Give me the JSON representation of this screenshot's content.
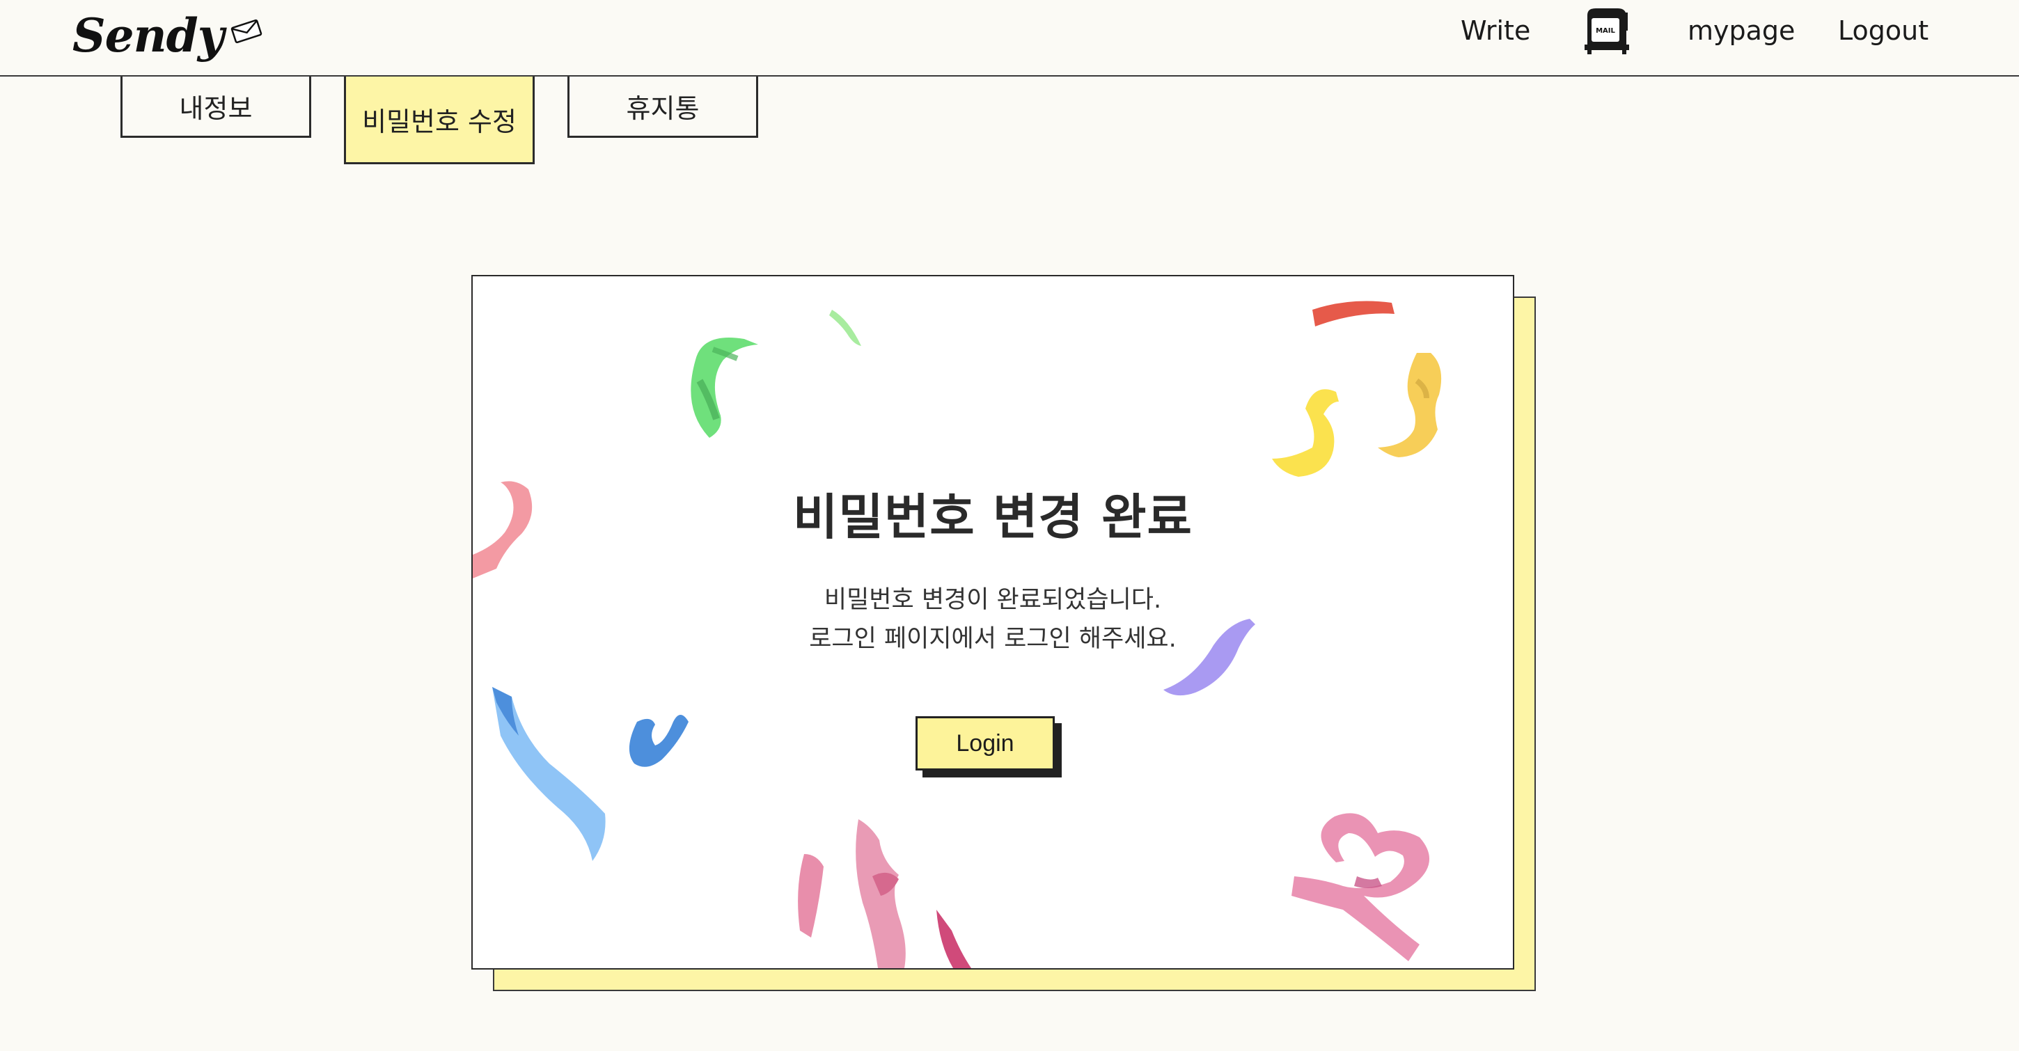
{
  "header": {
    "logo_text": "Sendy",
    "nav": {
      "write": "Write",
      "mypage": "mypage",
      "logout": "Logout"
    },
    "mail_icon_label": "MAIL"
  },
  "tabs": [
    {
      "label": "내정보",
      "active": false
    },
    {
      "label": "비밀번호 수정",
      "active": true
    },
    {
      "label": "휴지통",
      "active": false
    }
  ],
  "card": {
    "title": "비밀번호 변경 완료",
    "message_line1": "비밀번호 변경이 완료되었습니다.",
    "message_line2": "로그인 페이지에서 로그인 해주세요.",
    "login_label": "Login"
  },
  "colors": {
    "page_bg": "#fbfaf5",
    "accent_yellow": "#fdf5a6",
    "button_yellow": "#fdf39a",
    "border": "#2a2a2a"
  }
}
